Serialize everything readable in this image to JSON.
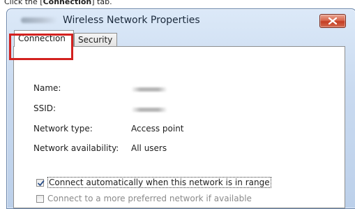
{
  "caption": {
    "prefix": "Click the [",
    "bold": "Connection",
    "suffix": "] tab."
  },
  "window": {
    "title": "Wireless Network Properties",
    "close_symbol": "×"
  },
  "tabs": [
    {
      "label": "Connection",
      "selected": true
    },
    {
      "label": "Security",
      "selected": false
    }
  ],
  "fields": {
    "name_label": "Name:",
    "ssid_label": "SSID:",
    "network_type_label": "Network type:",
    "network_type_value": "Access point",
    "availability_label": "Network availability:",
    "availability_value": "All users"
  },
  "checkboxes": [
    {
      "label": "Connect automatically when this network is in range",
      "checked": true
    },
    {
      "label": "Connect to a more preferred network if available",
      "checked": false
    }
  ],
  "colors": {
    "highlight": "#d3211f",
    "close_button": "#c43d22"
  }
}
